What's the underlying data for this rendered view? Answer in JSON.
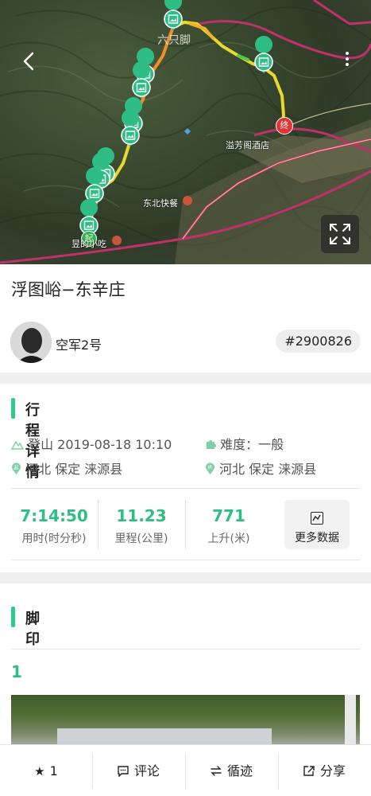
{
  "status_bar": {
    "left_text": "",
    "right_text": ""
  },
  "map": {
    "watermark": "六只脚",
    "poi_labels": {
      "hotel": "溢芳阁酒店",
      "restaurant": "东北快餐",
      "start_area": "昱的小吃"
    },
    "end_marker": "终",
    "start_marker": "起",
    "route_colors": {
      "green": "#4fc94f",
      "yellow": "#e8d92c",
      "orange": "#f0902a"
    },
    "road_color": "#c0306a"
  },
  "trip": {
    "title": "浮图峪−东辛庄",
    "author": "空军2号",
    "route_id": "#2900826"
  },
  "details": {
    "heading": "行程详情",
    "activity": "登山 2019-08-18 10:10",
    "difficulty": "难度：一般",
    "start_location": "河北 保定 涞源县",
    "end_location": "河北 保定 涞源县",
    "start_tag": "起",
    "end_tag": "终"
  },
  "stats": {
    "duration": {
      "value": "7:14:50",
      "label": "用时(时分秒)"
    },
    "distance": {
      "value": "11.23",
      "label": "里程(公里)"
    },
    "ascent": {
      "value": "771",
      "label": "上升(米)"
    },
    "more_label": "更多数据"
  },
  "footprints": {
    "heading": "脚印",
    "first_index": "1"
  },
  "bottom_bar": {
    "star_count": "1",
    "comment_label": "评论",
    "follow_label": "循迹",
    "share_label": "分享"
  },
  "colors": {
    "accent": "#2ebd85",
    "accent_bar": "#2ecc8a"
  }
}
